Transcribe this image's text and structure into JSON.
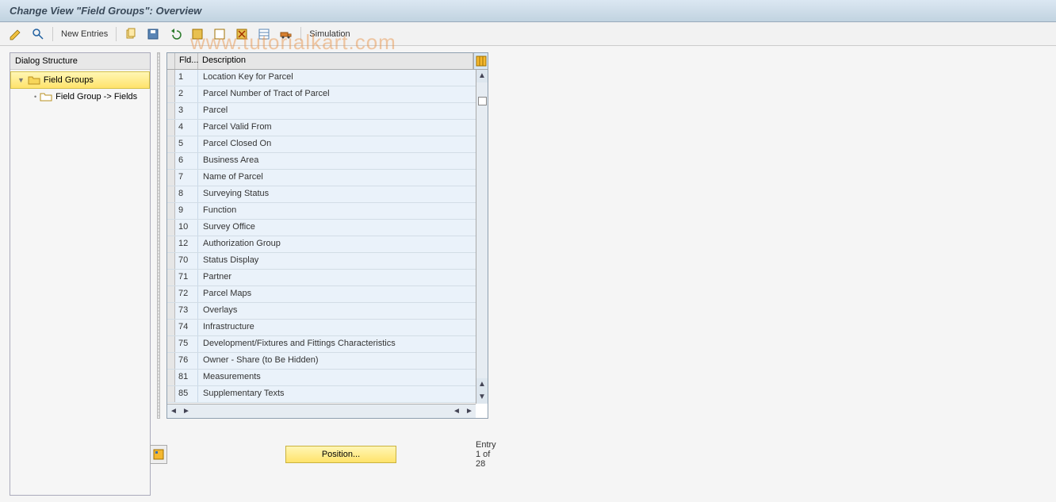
{
  "title": "Change View \"Field Groups\": Overview",
  "toolbar": {
    "new_entries": "New Entries",
    "simulation": "Simulation"
  },
  "watermark": "www.tutorialkart.com",
  "tree": {
    "title": "Dialog Structure",
    "root": "Field Groups",
    "child": "Field Group -> Fields"
  },
  "grid": {
    "col_fld": "Fld...",
    "col_desc": "Description",
    "rows": [
      {
        "fld": "1",
        "desc": "Location Key for Parcel"
      },
      {
        "fld": "2",
        "desc": "Parcel Number of Tract of Parcel"
      },
      {
        "fld": "3",
        "desc": "Parcel"
      },
      {
        "fld": "4",
        "desc": "Parcel Valid From"
      },
      {
        "fld": "5",
        "desc": "Parcel Closed On"
      },
      {
        "fld": "6",
        "desc": "Business Area"
      },
      {
        "fld": "7",
        "desc": "Name of Parcel"
      },
      {
        "fld": "8",
        "desc": "Surveying Status"
      },
      {
        "fld": "9",
        "desc": "Function"
      },
      {
        "fld": "10",
        "desc": "Survey Office"
      },
      {
        "fld": "12",
        "desc": "Authorization Group"
      },
      {
        "fld": "70",
        "desc": "Status Display"
      },
      {
        "fld": "71",
        "desc": "Partner"
      },
      {
        "fld": "72",
        "desc": "Parcel Maps"
      },
      {
        "fld": "73",
        "desc": "Overlays"
      },
      {
        "fld": "74",
        "desc": "Infrastructure"
      },
      {
        "fld": "75",
        "desc": "Development/Fixtures and Fittings Characteristics"
      },
      {
        "fld": "76",
        "desc": "Owner - Share (to Be Hidden)"
      },
      {
        "fld": "81",
        "desc": "Measurements"
      },
      {
        "fld": "85",
        "desc": "Supplementary Texts"
      }
    ]
  },
  "footer": {
    "position_label": "Position...",
    "entry_text": "Entry 1 of 28"
  }
}
